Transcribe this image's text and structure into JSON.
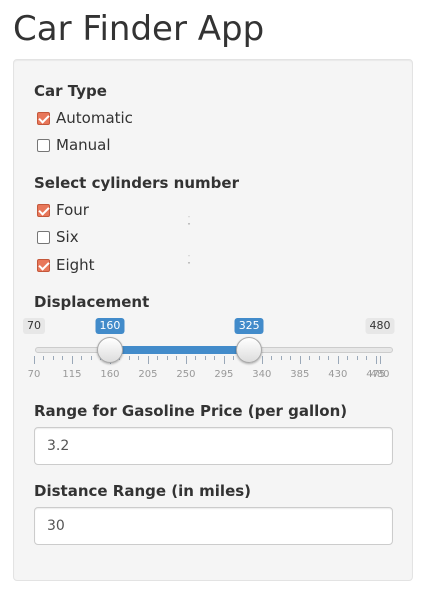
{
  "app": {
    "title": "Car Finder App"
  },
  "car_type": {
    "label": "Car Type",
    "options": [
      {
        "label": "Automatic",
        "checked": true
      },
      {
        "label": "Manual",
        "checked": false
      }
    ]
  },
  "cylinders": {
    "label": "Select cylinders number",
    "options": [
      {
        "label": "Four",
        "checked": true
      },
      {
        "label": "Six",
        "checked": false
      },
      {
        "label": "Eight",
        "checked": true
      }
    ]
  },
  "displacement": {
    "label": "Displacement",
    "min": 70,
    "max": 480,
    "from": 160,
    "to": 325,
    "min_label": "70",
    "max_label": "480",
    "from_label": "160",
    "to_label": "325",
    "tick_labels": [
      "70",
      "115",
      "160",
      "205",
      "250",
      "295",
      "340",
      "385",
      "430",
      "475",
      "480"
    ]
  },
  "gas_price": {
    "label": "Range for Gasoline Price (per gallon)",
    "value": "3.2"
  },
  "distance": {
    "label": "Distance Range (in miles)",
    "value": "30"
  },
  "colors": {
    "accent": "#428bca",
    "checkbox_checked": "#e8775a",
    "panel_bg": "#f5f5f5"
  }
}
